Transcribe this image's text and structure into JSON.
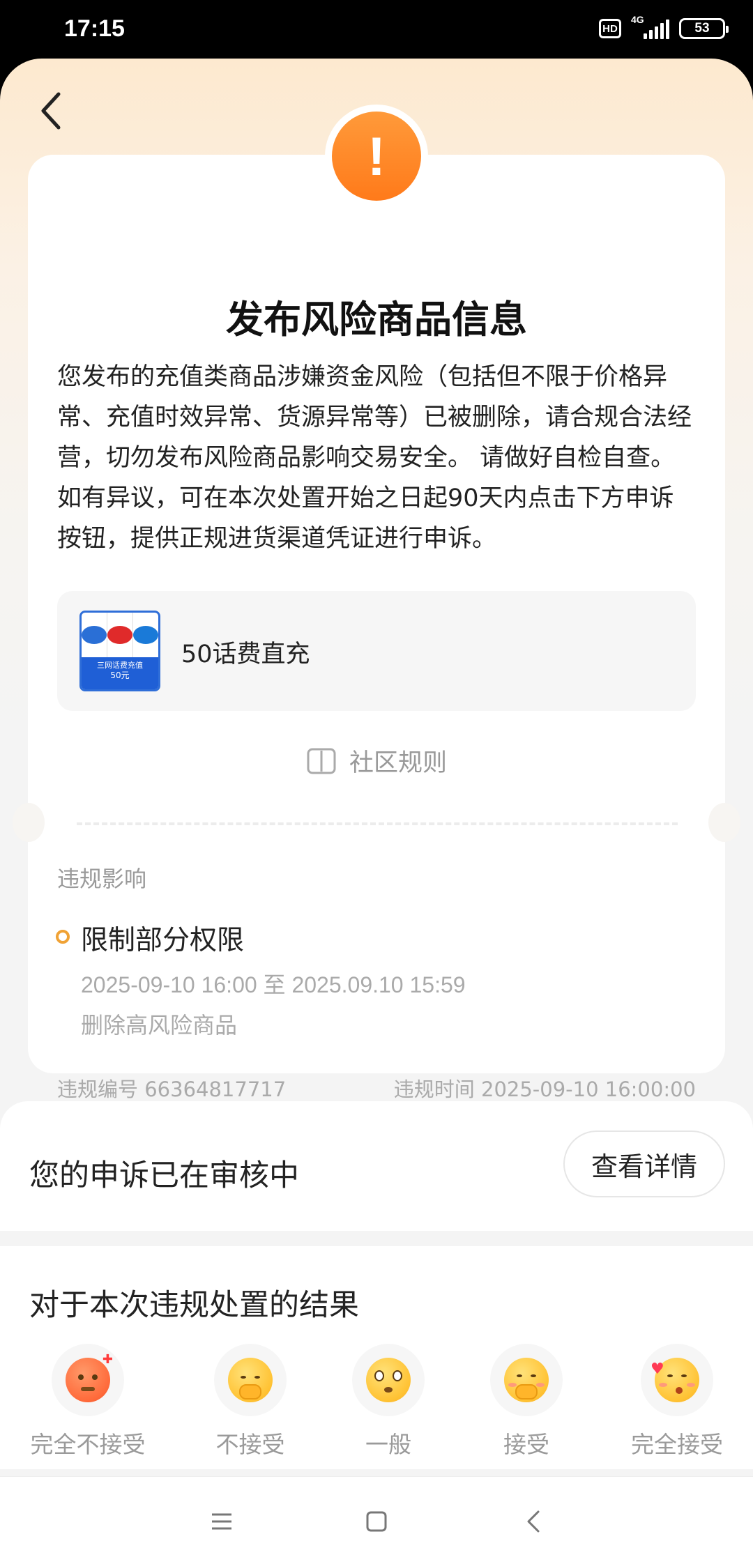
{
  "status_bar": {
    "time": "17:15",
    "hd": "HD",
    "network": "4G",
    "battery": "53"
  },
  "header": {
    "back_icon": "chevron-left-icon"
  },
  "notice": {
    "alert_icon": "exclamation-icon",
    "title": "发布风险商品信息",
    "description": "您发布的充值类商品涉嫌资金风险（包括但不限于价格异常、充值时效异常、货源异常等）已被删除，请合规合法经营，切勿发布风险商品影响交易安全。 请做好自检自查。如有异议，可在本次处置开始之日起90天内点击下方申诉按钮，提供正规进货渠道凭证进行申诉。",
    "product": {
      "name": "50话费直充",
      "thumb_banner": "三网话费充值",
      "thumb_amount": "50元"
    },
    "rules_link": "社区规则",
    "rules_icon": "book-icon"
  },
  "impact": {
    "section_label": "违规影响",
    "title": "限制部分权限",
    "time_range": "2025-09-10 16:00 至 2025.09.10 15:59",
    "action": "删除高风险商品",
    "violation_id": "违规编号 66364817717",
    "violation_time": "违规时间 2025-09-10 16:00:00"
  },
  "appeal": {
    "status_text": "您的申诉已在审核中",
    "detail_button": "查看详情"
  },
  "feedback": {
    "title": "对于本次违规处置的结果",
    "options": [
      {
        "label": "完全不接受",
        "icon": "angry-face-icon"
      },
      {
        "label": "不接受",
        "icon": "unamused-face-icon"
      },
      {
        "label": "一般",
        "icon": "neutral-face-icon"
      },
      {
        "label": "接受",
        "icon": "shy-face-icon"
      },
      {
        "label": "完全接受",
        "icon": "kissing-face-icon"
      }
    ]
  },
  "nav": {
    "menu_icon": "menu-icon",
    "home_icon": "square-icon",
    "back_icon": "back-triangle-icon"
  },
  "colors": {
    "accent_orange": "#ff8a2a",
    "impact_dot": "#f0a235",
    "thumb_blue": "#1f5fd6"
  }
}
